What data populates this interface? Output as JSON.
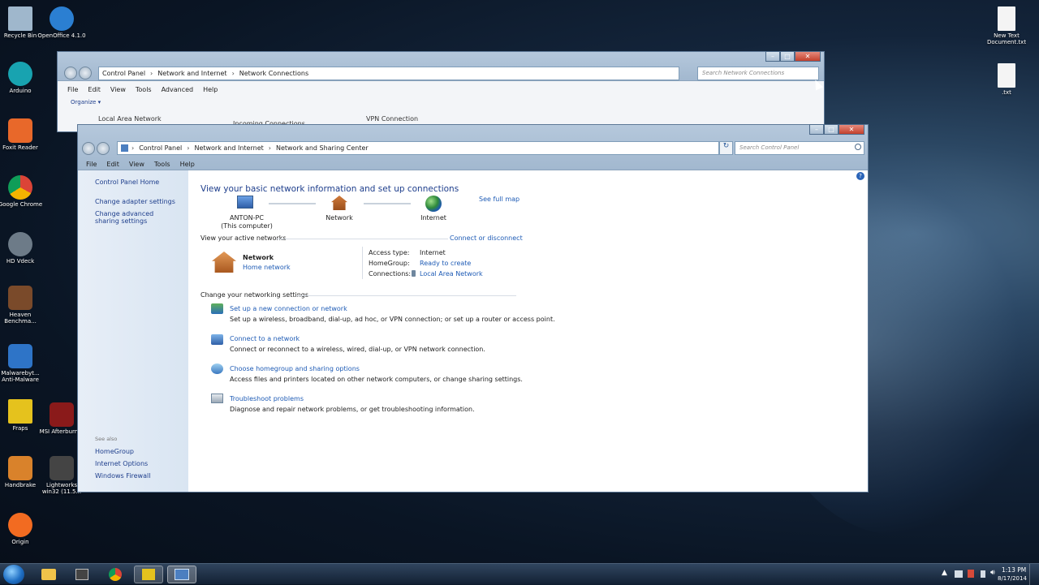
{
  "desktop": {
    "left_icons": [
      {
        "label": "Recycle Bin",
        "color": "#9fb7cc"
      },
      {
        "label": "Arduino",
        "color": "#18a3b0"
      },
      {
        "label": "Foxit Reader",
        "color": "#e8682a"
      },
      {
        "label": "Google Chrome",
        "color": "#d93a2c"
      },
      {
        "label": "HD Vdeck",
        "color": "#6d7b88"
      },
      {
        "label": "Heaven Benchma...",
        "color": "#7a4a2a"
      },
      {
        "label": "Malwarebyt... Anti-Malware",
        "color": "#2e74c7"
      },
      {
        "label": "Fraps",
        "color": "#e5c21d"
      },
      {
        "label": "Handbrake",
        "color": "#d9822b"
      },
      {
        "label": "Origin",
        "color": "#f26b21"
      }
    ],
    "second_col": [
      {
        "label": "OpenOffice 4.1.0",
        "color": "#2b7fd2"
      },
      {
        "label": "MSI Afterburner",
        "color": "#8a1a1a"
      },
      {
        "label": "Lightworks win32 (11.5...",
        "color": "#444"
      }
    ],
    "right_icons": [
      {
        "label": "New Text Document.txt"
      },
      {
        "label": ".txt"
      }
    ]
  },
  "back_window": {
    "breadcrumb": [
      "Control Panel",
      "Network and Internet",
      "Network Connections"
    ],
    "search_placeholder": "Search Network Connections",
    "menu": [
      "File",
      "Edit",
      "View",
      "Tools",
      "Advanced",
      "Help"
    ],
    "organize": "Organize ▾",
    "items": [
      "Local Area Network",
      "Incoming Connections",
      "VPN Connection"
    ]
  },
  "main": {
    "breadcrumb": [
      "Control Panel",
      "Network and Internet",
      "Network and Sharing Center"
    ],
    "search_placeholder": "Search Control Panel",
    "menu": [
      "File",
      "Edit",
      "View",
      "Tools",
      "Help"
    ],
    "sidebar": {
      "links": [
        "Control Panel Home",
        "Change adapter settings",
        "Change advanced sharing settings"
      ],
      "see_also_title": "See also",
      "see_also": [
        "HomeGroup",
        "Internet Options",
        "Windows Firewall"
      ]
    },
    "title": "View your basic network information and set up connections",
    "map": {
      "computer": "ANTON-PC",
      "computer_sub": "(This computer)",
      "network": "Network",
      "internet": "Internet",
      "full_map": "See full map"
    },
    "active_label": "View your active networks",
    "connect_link": "Connect or disconnect",
    "active": {
      "name": "Network",
      "type": "Home network",
      "access_label": "Access type:",
      "access_val": "Internet",
      "homegroup_label": "HomeGroup:",
      "homegroup_val": "Ready to create",
      "conn_label": "Connections:",
      "conn_val": "Local Area Network"
    },
    "settings_label": "Change your networking settings",
    "tasks": [
      {
        "link": "Set up a new connection or network",
        "desc": "Set up a wireless, broadband, dial-up, ad hoc, or VPN connection; or set up a router or access point."
      },
      {
        "link": "Connect to a network",
        "desc": "Connect or reconnect to a wireless, wired, dial-up, or VPN network connection."
      },
      {
        "link": "Choose homegroup and sharing options",
        "desc": "Access files and printers located on other network computers, or change sharing settings."
      },
      {
        "link": "Troubleshoot problems",
        "desc": "Diagnose and repair network problems, or get troubleshooting information."
      }
    ]
  },
  "taskbar": {
    "time": "1:13 PM",
    "date": "8/17/2014"
  }
}
